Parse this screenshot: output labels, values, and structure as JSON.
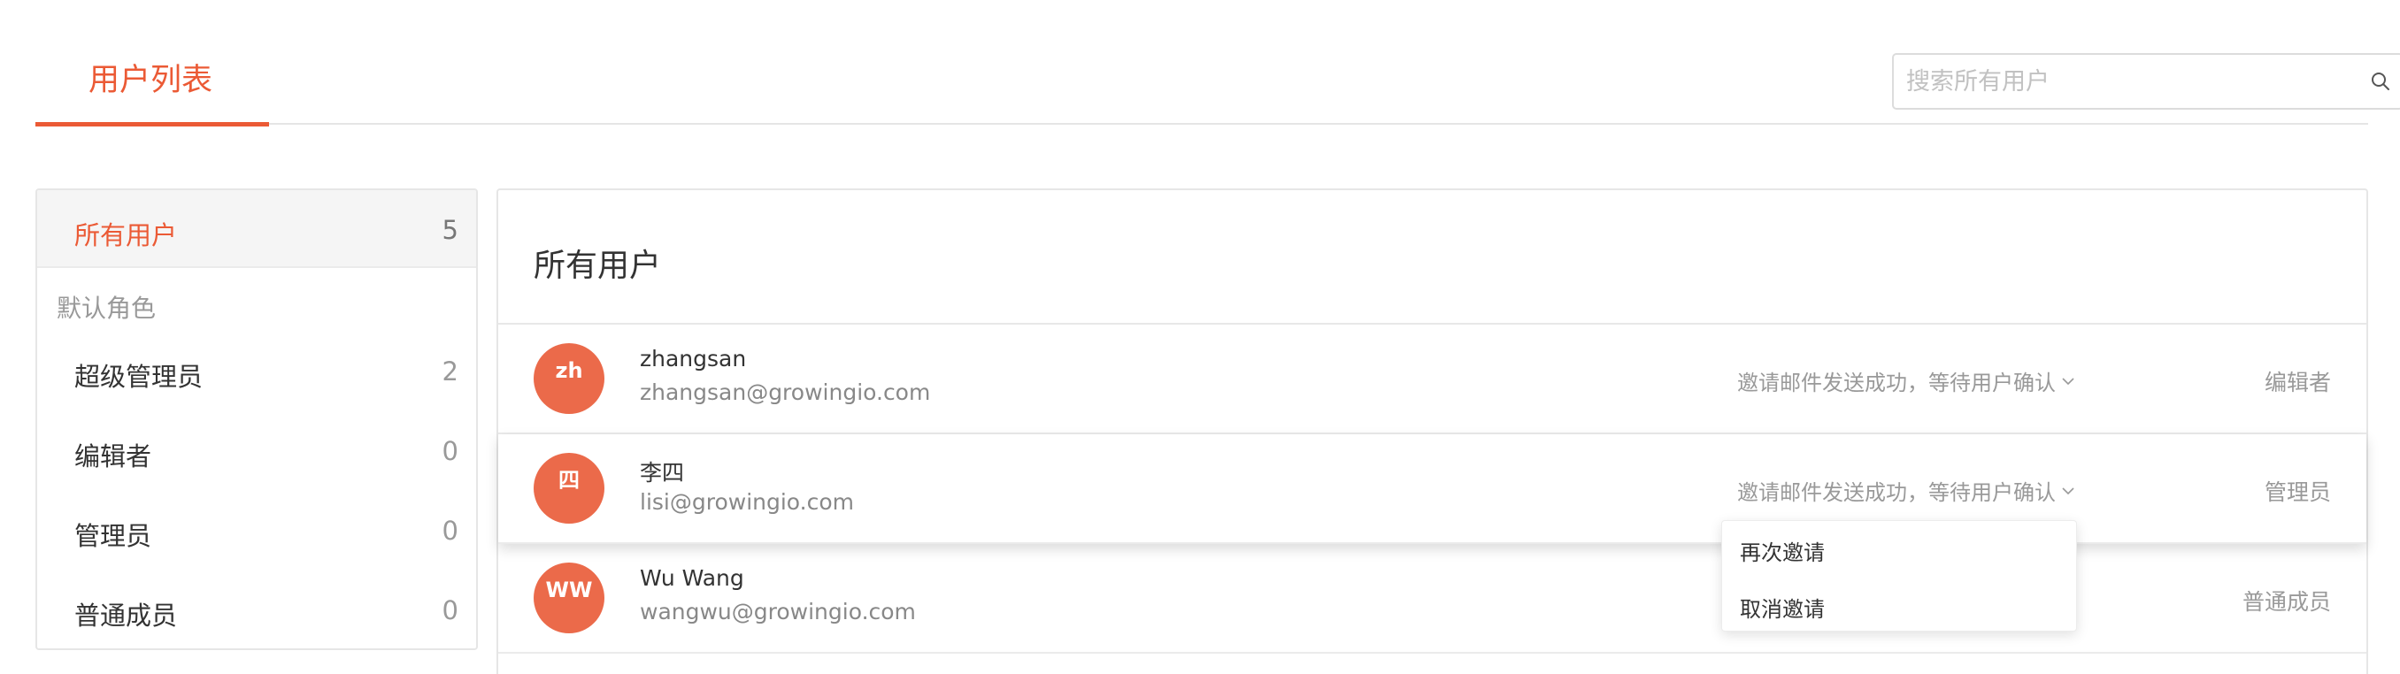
{
  "header": {
    "active_tab": "用户列表",
    "search_placeholder": "搜索所有用户"
  },
  "sidebar": {
    "all": {
      "label": "所有用户",
      "count": "5"
    },
    "group_label": "默认角色",
    "roles": [
      {
        "label": "超级管理员",
        "count": "2"
      },
      {
        "label": "编辑者",
        "count": "0"
      },
      {
        "label": "管理员",
        "count": "0"
      },
      {
        "label": "普通成员",
        "count": "0"
      }
    ]
  },
  "main": {
    "title": "所有用户",
    "users": [
      {
        "initials": "zh",
        "name": "zhangsan",
        "email": "zhangsan@growingio.com",
        "status": "邀请邮件发送成功，等待用户确认",
        "role": "编辑者"
      },
      {
        "initials": "四",
        "name": "李四",
        "email": "lisi@growingio.com",
        "status": "邀请邮件发送成功，等待用户确认",
        "role": "管理员"
      },
      {
        "initials": "WW",
        "name": "Wu Wang",
        "email": "wangwu@growingio.com",
        "status": "",
        "role": "普通成员"
      }
    ]
  },
  "dropdown": {
    "items": [
      "再次邀请",
      "取消邀请"
    ]
  },
  "colors": {
    "accent": "#eb5a35",
    "avatar": "#eb6a4a"
  }
}
